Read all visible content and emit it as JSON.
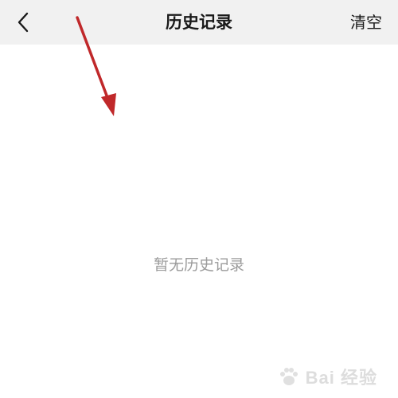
{
  "nav": {
    "title": "历史记录",
    "clear_label": "清空",
    "back_icon": "chevron-left-icon"
  },
  "main": {
    "empty_text": "暂无历史记录"
  },
  "watermark": {
    "text": "Bai 经验"
  },
  "colors": {
    "nav_background": "#f1f1f1",
    "annotation_arrow": "#c0282a",
    "empty_text": "#9b9b9b"
  }
}
